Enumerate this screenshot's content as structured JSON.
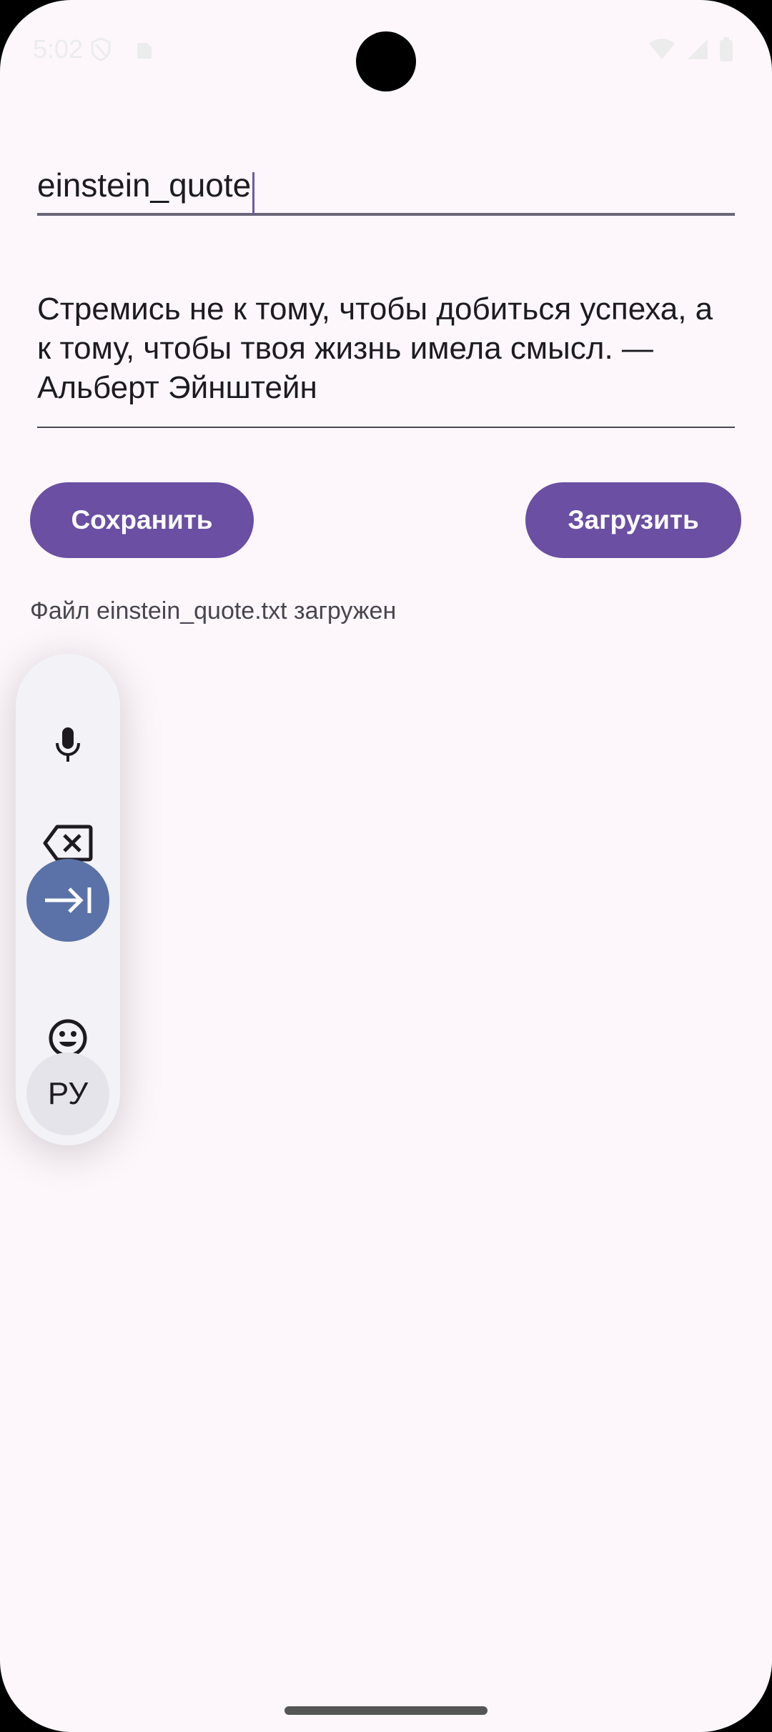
{
  "status_bar": {
    "time": "5:02"
  },
  "form": {
    "filename_value": "einstein_quote",
    "content_value": "Стремись не к тому, чтобы добиться успеха, а к тому, чтобы твоя жизнь имела смысл. — Альберт Эйнштейн"
  },
  "buttons": {
    "save_label": "Сохранить",
    "load_label": "Загрузить"
  },
  "status_message": "Файл einstein_quote.txt загружен",
  "floating_toolbar": {
    "items": [
      {
        "icon": "microphone-icon"
      },
      {
        "icon": "backspace-icon"
      },
      {
        "icon": "tab-icon"
      },
      {
        "icon": "emoji-icon"
      }
    ],
    "language_label": "РУ"
  },
  "colors": {
    "background": "#fdf7fb",
    "button": "#6a4fa3",
    "tab_highlight": "#5b72a8"
  }
}
